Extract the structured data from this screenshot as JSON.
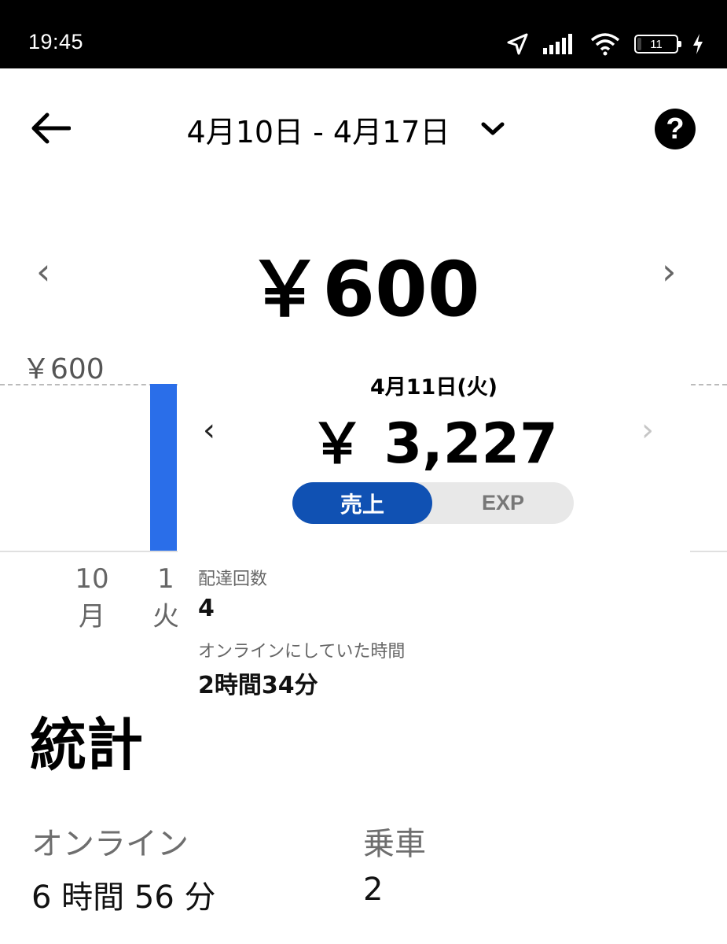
{
  "status_bar": {
    "time": "19:45",
    "battery_level": "11",
    "battery_fraction": 0.11,
    "icons": [
      "location-arrow-icon",
      "signal-icon",
      "wifi-icon",
      "battery-icon",
      "charging-bolt-icon"
    ]
  },
  "header": {
    "date_range": "4月10日 - 4月17日",
    "icons": [
      "back-arrow-icon",
      "chevron-down-icon",
      "help-icon"
    ],
    "help_glyph": "?"
  },
  "summary": {
    "total": "￥600",
    "prev_glyph": "‹",
    "next_glyph": "›"
  },
  "chart_data": {
    "type": "bar",
    "max_label": "￥600",
    "categories": [
      {
        "day": "10",
        "weekday": "月"
      },
      {
        "day": "1",
        "weekday": "火"
      }
    ],
    "values": [
      0,
      600
    ],
    "ylim": [
      0,
      600
    ],
    "color": "#2a6ee9"
  },
  "popup": {
    "date": "4月11日(火)",
    "amount": "￥ 3,227",
    "prev_glyph": "‹",
    "next_glyph": "›",
    "toggle": {
      "selected": "売上",
      "other": "EXP",
      "selected_color": "#1051b3"
    },
    "deliveries_label": "配達回数",
    "deliveries_value": "4",
    "online_label": "オンラインにしていた時間",
    "online_value": "2時間34分"
  },
  "stats": {
    "title": "統計",
    "online_label": "オンライン",
    "online_value": "6 時間 56 分",
    "rides_label": "乗車",
    "rides_value": "2"
  }
}
